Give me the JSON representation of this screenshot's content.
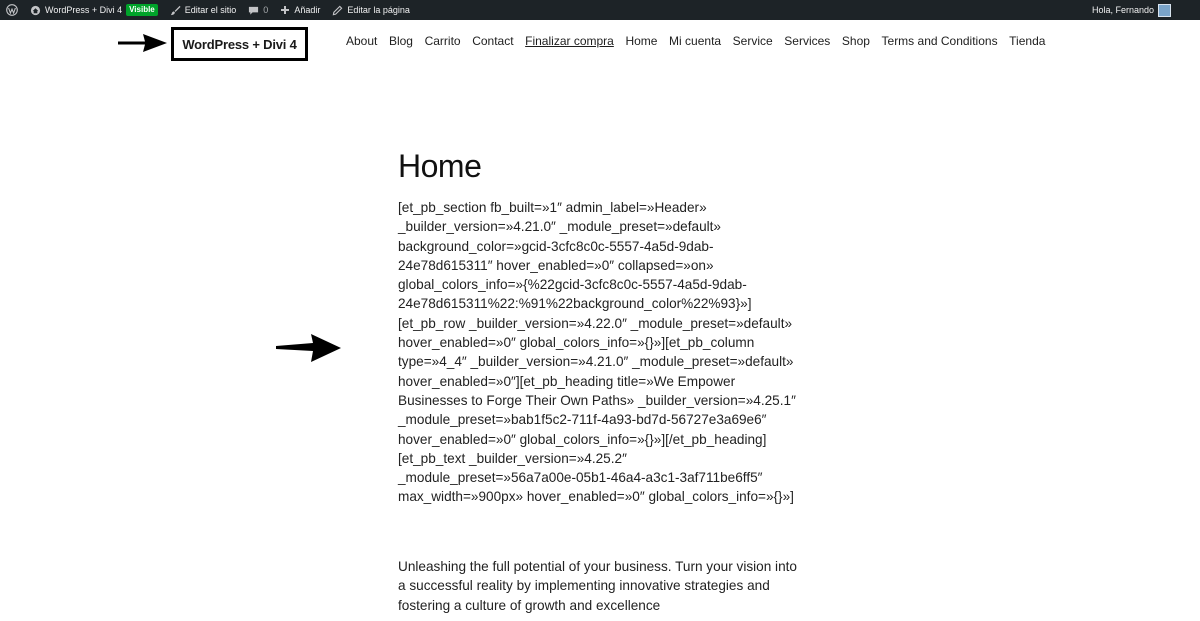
{
  "adminbar": {
    "site_name": "WordPress + Divi 4",
    "visibility_badge": "Visible",
    "edit_site": "Editar el sitio",
    "comments_count": "0",
    "add_new": "Añadir",
    "edit_page": "Editar la página",
    "greeting": "Hola, Fernando",
    "colors": {
      "background": "#1d2327",
      "badge": "#00a32a"
    }
  },
  "header": {
    "logo": "WordPress + Divi 4",
    "nav": [
      "About",
      "Blog",
      "Carrito",
      "Contact",
      "Finalizar compra",
      "Home",
      "Mi cuenta",
      "Service",
      "Services",
      "Shop",
      "Terms and Conditions",
      "Tienda"
    ],
    "current_item": "Finalizar compra"
  },
  "content": {
    "title": "Home",
    "shortcode_text": "[et_pb_section fb_built=»1″ admin_label=»Header» _builder_version=»4.21.0″ _module_preset=»default» background_color=»gcid-3cfc8c0c-5557-4a5d-9dab-24e78d615311″ hover_enabled=»0″ collapsed=»on» global_colors_info=»{%22gcid-3cfc8c0c-5557-4a5d-9dab-24e78d615311%22:%91%22background_color%22%93}»] [et_pb_row _builder_version=»4.22.0″ _module_preset=»default» hover_enabled=»0″ global_colors_info=»{}»][et_pb_column type=»4_4″ _builder_version=»4.21.0″ _module_preset=»default» hover_enabled=»0″][et_pb_heading title=»We Empower Businesses to Forge Their Own Paths» _builder_version=»4.25.1″ _module_preset=»bab1f5c2-711f-4a93-bd7d-56727e3a69e6″ hover_enabled=»0″ global_colors_info=»{}»][/et_pb_heading] [et_pb_text _builder_version=»4.25.2″ _module_preset=»56a7a00e-05b1-46a4-a3c1-3af711be6ff5″ max_width=»900px» hover_enabled=»0″ global_colors_info=»{}»]",
    "intro_text": "Unleashing the full potential of your business. Turn your vision into a successful reality by implementing innovative strategies and fostering a culture of growth and excellence"
  },
  "icons": {
    "wp_logo": "wordpress-icon",
    "site": "home-icon",
    "edit_site": "brush-icon",
    "comments": "comment-icon",
    "add_new": "plus-icon",
    "edit_page": "pencil-icon",
    "user": "avatar-icon",
    "annotations": "arrow-right-icon"
  }
}
